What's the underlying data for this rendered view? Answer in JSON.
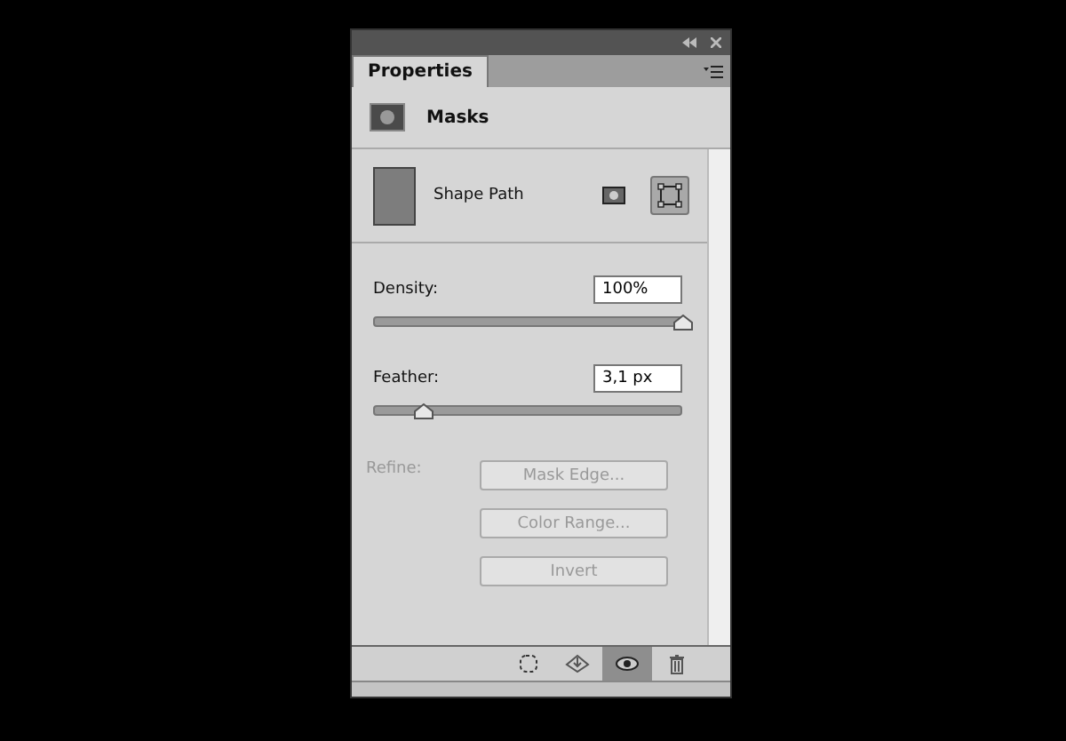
{
  "panel": {
    "tab": {
      "label": "Properties",
      "selected": true
    },
    "header": {
      "title": "Masks"
    },
    "mask": {
      "name": "Shape Path",
      "modes": [
        {
          "kind": "pixel",
          "selected": false
        },
        {
          "kind": "vector",
          "selected": true
        }
      ]
    },
    "sliders": [
      {
        "label": "Density:",
        "value": "100%",
        "level": 1.0
      },
      {
        "label": "Feather:",
        "value": "3,1 px",
        "level": 0.16
      }
    ],
    "refine": {
      "label": "Refine:",
      "disabled": true,
      "buttons": [
        {
          "label": "Mask Edge...",
          "disabled": true
        },
        {
          "label": "Color Range...",
          "disabled": true
        },
        {
          "label": "Invert",
          "disabled": true
        }
      ]
    },
    "footer": [
      {
        "kind": "selection",
        "selected": false
      },
      {
        "kind": "apply",
        "selected": false
      },
      {
        "kind": "visibility",
        "selected": true
      },
      {
        "kind": "delete",
        "selected": false
      }
    ]
  }
}
